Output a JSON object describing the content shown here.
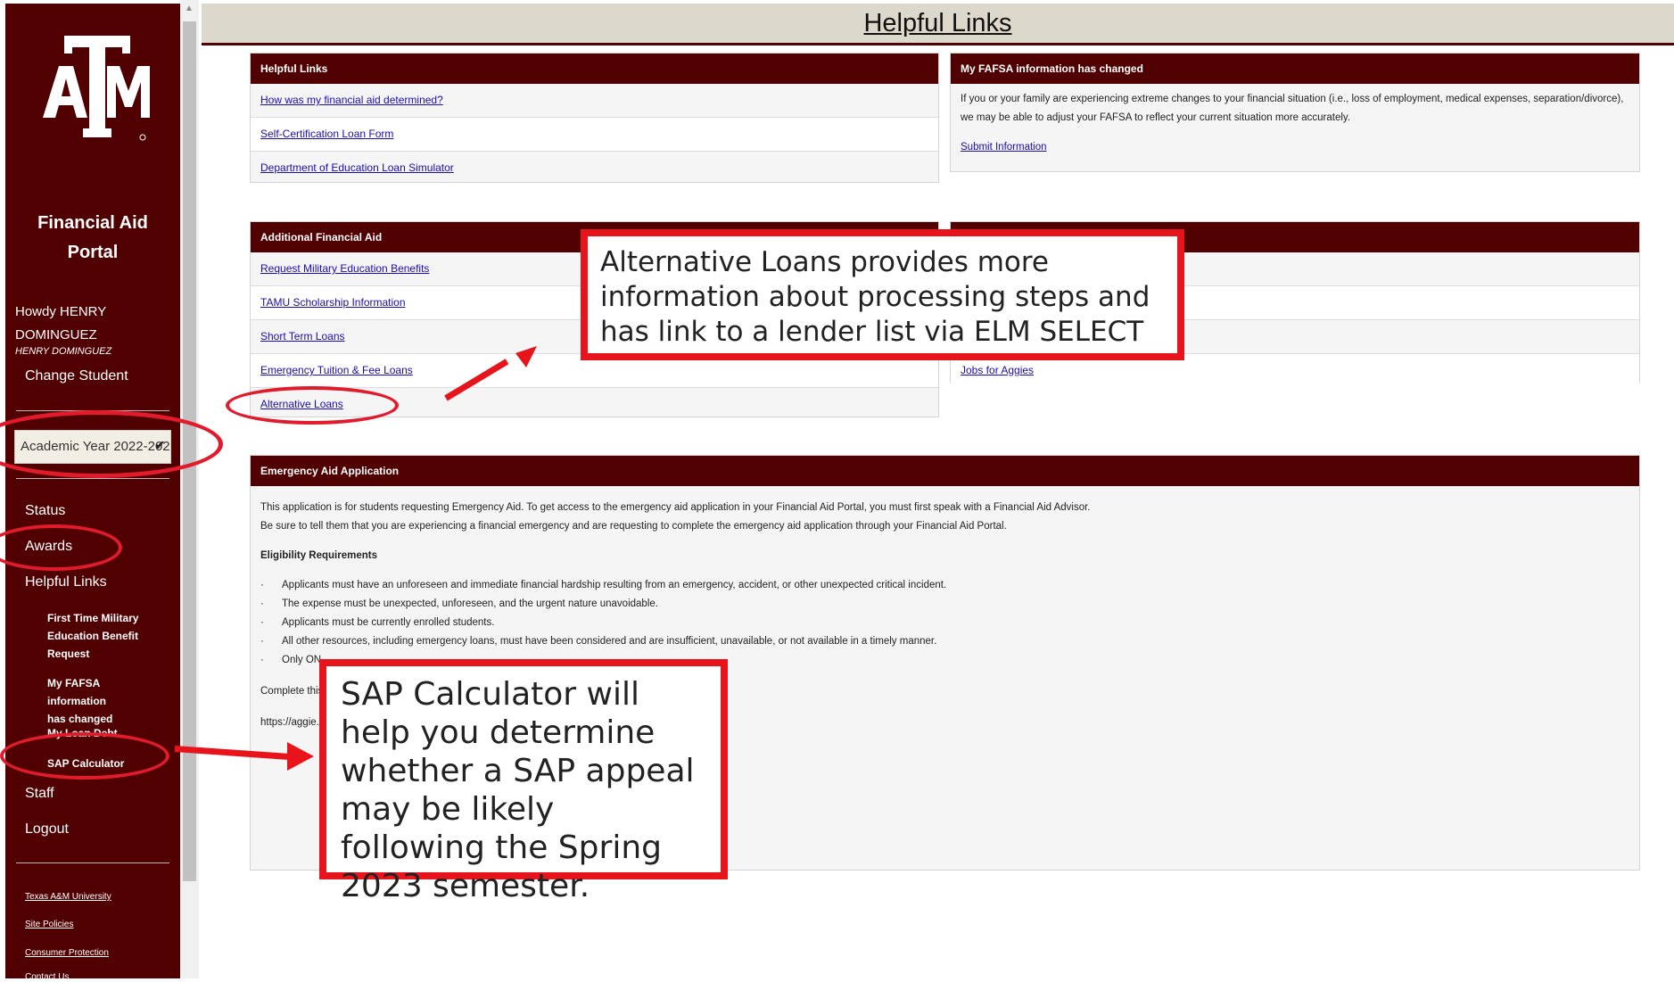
{
  "header": {
    "title": "Helpful Links"
  },
  "sidebar": {
    "logo_alt": "Texas A&M ATM logo",
    "portal_title_line1": "Financial Aid",
    "portal_title_line2": "Portal",
    "howdy_line1": "Howdy HENRY",
    "howdy_line2": "DOMINGUEZ",
    "howdy_sub": "HENRY DOMINGUEZ",
    "change_student": "Change Student",
    "academic_year": "Academic Year 2022-202",
    "nav": {
      "status": "Status",
      "awards": "Awards",
      "helpful_links": "Helpful Links",
      "staff": "Staff",
      "logout": "Logout"
    },
    "subnav": {
      "military_line1": "First Time Military",
      "military_line2": "Education Benefit",
      "military_line3": "Request",
      "fafsa_line1": "My FAFSA information",
      "fafsa_line2": "has changed",
      "loan_debt": "My Loan Debt",
      "sap": "SAP Calculator"
    },
    "footer": {
      "tamu": "Texas A&M University",
      "policies": "Site Policies",
      "consumer": "Consumer Protection",
      "contact": "Contact Us"
    }
  },
  "helpful_links_panel": {
    "heading": "Helpful Links",
    "links": [
      "How was my financial aid determined?",
      "Self-Certification Loan Form",
      "Department of Education Loan Simulator"
    ]
  },
  "fafsa_panel": {
    "heading": "My FAFSA information has changed",
    "text": "If you or your family are experiencing extreme changes to your financial situation (i.e., loss of employment, medical expenses, separation/divorce), we may be able to adjust your FAFSA to reflect your current situation more accurately.",
    "link": "Submit Information"
  },
  "additional_panel": {
    "heading": "Additional Financial Aid",
    "links": [
      "Request Military Education Benefits",
      "TAMU Scholarship Information",
      "Short Term Loans",
      "Emergency Tuition & Fee Loans",
      "Alternative Loans"
    ]
  },
  "jobs_panel": {
    "link": "Jobs for Aggies"
  },
  "emergency_panel": {
    "heading": "Emergency Aid Application",
    "intro1": "This application is for students requesting Emergency Aid. To get access to the emergency aid application in your Financial Aid Portal, you must first speak with a Financial Aid Advisor.",
    "intro2": "Be sure to tell them that you are experiencing a financial emergency and are requesting to complete the emergency aid application through your Financial Aid Portal.",
    "elig_heading": "Eligibility Requirements",
    "requirements": [
      "Applicants must have an unforeseen and immediate financial hardship resulting from an emergency, accident, or other unexpected critical incident.",
      "The expense must be unexpected, unforeseen, and the urgent nature unavoidable.",
      "Applicants must be currently enrolled students.",
      "All other resources, including emergency loans, must have been considered and are insufficient, unavailable, or not available in a timely manner.",
      "Only ON"
    ],
    "complete_text": "Complete this",
    "url_text": "https://aggie.t"
  },
  "annotations": {
    "alt_loans_callout": "Alternative Loans provides more information about processing steps and has link to a lender list via ELM SELECT",
    "sap_callout": "SAP Calculator will help you determine whether a SAP appeal may be likely following the Spring 2023 semester."
  },
  "colors": {
    "maroon": "#500000",
    "callout_red": "#e8141c",
    "link_blue": "#1a0dab"
  }
}
